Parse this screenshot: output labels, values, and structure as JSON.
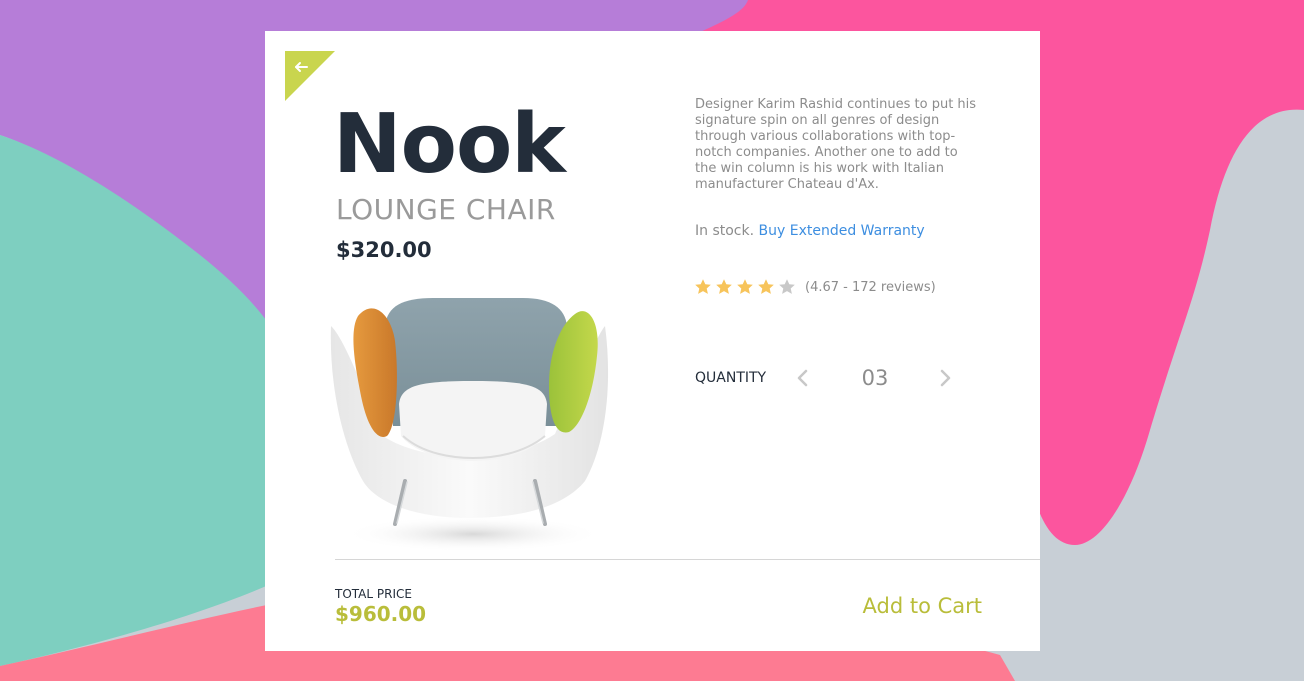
{
  "colors": {
    "purple_blob": "#b67dd8",
    "pink_blob": "#fc559e",
    "teal_blob": "#7ecfc0",
    "coral_blob": "#fd7b92",
    "gray_blob": "#c8cfd6",
    "card_background": "#ffffff",
    "back_corner": "#c9d54e",
    "heading_dark": "#232d3a",
    "muted_text": "#8c8c8c",
    "link_blue": "#3d8ee0",
    "accent_olive": "#b9bd3a",
    "star_filled": "#f7c45b",
    "star_empty": "#c8c8c8",
    "chevron": "#c8c8c8"
  },
  "back_button": {
    "icon": "arrow-left-icon"
  },
  "product": {
    "name": "Nook",
    "type": "LOUNGE CHAIR",
    "unit_price": "$320.00",
    "image_icon": "lounge-chair-image",
    "description": "Designer Karim Rashid continues to put his signature spin on all genres of design through various collaborations with top-notch companies. Another one to add to the win column is his work with Italian manufacturer Chateau d'Ax."
  },
  "stock": {
    "status": "In stock.",
    "warranty_link": "Buy Extended Warranty"
  },
  "rating": {
    "score": 4.67,
    "filled_stars": 4,
    "total_stars": 5,
    "reviews_text": "(4.67 - 172 reviews)"
  },
  "quantity": {
    "label": "QUANTITY",
    "value": "03",
    "prev_icon": "chevron-left-icon",
    "next_icon": "chevron-right-icon"
  },
  "footer": {
    "total_label": "TOTAL PRICE",
    "total_value": "$960.00",
    "add_to_cart": "Add to Cart"
  }
}
